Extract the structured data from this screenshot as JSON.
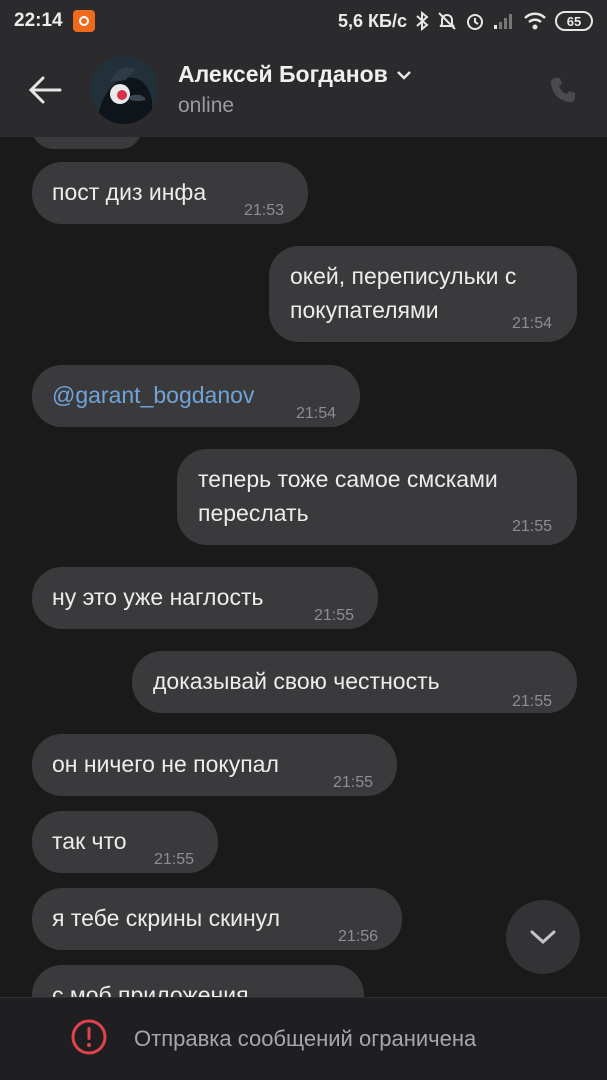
{
  "status_bar": {
    "time": "22:14",
    "network_speed": "5,6 КБ/с",
    "battery": "65"
  },
  "header": {
    "peer_name": "Алексей Богданов",
    "peer_status": "online"
  },
  "messages": [
    {
      "direction": "in",
      "text": "пост диз инфа",
      "time": "21:53"
    },
    {
      "direction": "out",
      "lines": [
        "окей, переписульки с",
        "покупателями"
      ],
      "time": "21:54"
    },
    {
      "direction": "in",
      "text": "@garant_bogdanov",
      "time": "21:54",
      "is_link": true
    },
    {
      "direction": "out",
      "lines": [
        "теперь тоже самое смсками",
        "переслать"
      ],
      "time": "21:55"
    },
    {
      "direction": "in",
      "text": "ну это уже наглость",
      "time": "21:55"
    },
    {
      "direction": "out",
      "text": "доказывай свою честность",
      "time": "21:55"
    },
    {
      "direction": "in",
      "text": "он ничего не покупал",
      "time": "21:55"
    },
    {
      "direction": "in",
      "text": "так что",
      "time": "21:55"
    },
    {
      "direction": "in",
      "text": "я тебе скрины скинул",
      "time": "21:56"
    },
    {
      "direction": "in",
      "text": "с моб приложения",
      "time": ""
    }
  ],
  "bottom_bar": {
    "notice": "Отправка сообщений ограничена"
  },
  "colors": {
    "background": "#1a1a1b",
    "header": "#2b2b2d",
    "bubble": "#3a3a3c",
    "link": "#71a3d8",
    "warning": "#e0434f"
  }
}
